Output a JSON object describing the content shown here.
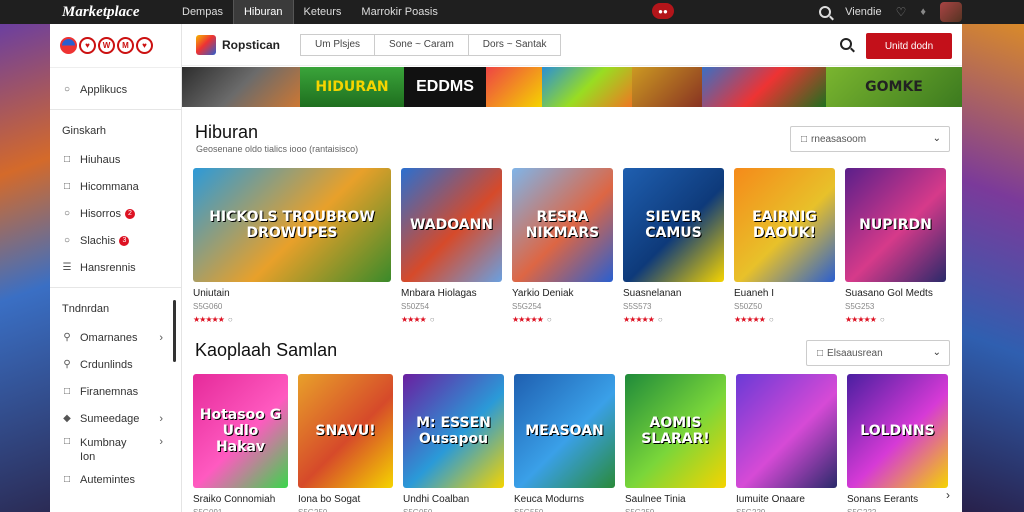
{
  "topbar": {
    "brand": "Marketplace",
    "tabs": [
      "Dempas",
      "Hiburan",
      "Keteurs",
      "Marrokir Poasis"
    ],
    "active_tab": 1,
    "notification": "",
    "user_label": "Viendie"
  },
  "sidebar": {
    "logo_chips": [
      "",
      "♥",
      "W",
      "M",
      "♥"
    ],
    "items_top": [
      {
        "label": "Applikucs",
        "icon": "circle-icon"
      }
    ],
    "section1_title": "Ginskarh",
    "items_mid": [
      {
        "label": "Hiuhaus",
        "icon": "book-icon",
        "badge": ""
      },
      {
        "label": "Hicommana",
        "icon": "card-icon",
        "badge": ""
      },
      {
        "label": "Hisorros",
        "icon": "circle-icon",
        "badge": "2"
      },
      {
        "label": "Slachis",
        "icon": "circle-icon",
        "badge": "3"
      },
      {
        "label": "Hansrennis",
        "icon": "list-icon",
        "badge": ""
      }
    ],
    "section2_title": "Tndnrdan",
    "items_bottom": [
      {
        "label": "Omarnanes",
        "icon": "search-icon",
        "chevron": "›"
      },
      {
        "label": "Crdunlinds",
        "icon": "search-icon",
        "chevron": ""
      },
      {
        "label": "Firanemnas",
        "icon": "book-icon",
        "chevron": ""
      },
      {
        "label": "Sumeedage",
        "icon": "tag-icon",
        "chevron": "›"
      },
      {
        "label": "Kumbnay",
        "sublabel": "Ion",
        "icon": "card-icon",
        "chevron": "›"
      },
      {
        "label": "Autemintes",
        "icon": "book-icon",
        "chevron": ""
      }
    ]
  },
  "header": {
    "store_name": "Ropstican",
    "chips": [
      "Um Plsjes",
      "Sone ~ Caram",
      "Dors ~ Santak"
    ],
    "cta_label": "Unitd dodn"
  },
  "banner": [
    "",
    "HIDURAN",
    "EDDMS",
    "",
    "",
    "",
    "",
    "GOMKE"
  ],
  "section1": {
    "title": "Hiburan",
    "subtitle": "Geosenane oldo tialics iooo (rantaisisco)",
    "dropdown": "rneasasoom",
    "cards": [
      {
        "thumb": "HICKOLS TROUBROW DROWUPES",
        "name": "Uniutain",
        "price": "S5G060",
        "stars": "★★★★★",
        "colors": [
          "#2d9ad8",
          "#e8a02a",
          "#3a8a2a"
        ]
      },
      {
        "thumb": "WADOANN",
        "name": "Mnbara Hiolagas",
        "price": "S50Z54",
        "stars": "★★★★",
        "colors": [
          "#2a6fd0",
          "#d64a2a",
          "#6aa0e0"
        ]
      },
      {
        "thumb": "RESRA NIKMARS",
        "name": "Yarkio Deniak",
        "price": "S5G254",
        "stars": "★★★★★",
        "colors": [
          "#7fb4e8",
          "#d64",
          "#2a5fd0"
        ]
      },
      {
        "thumb": "SIEVER CAMUS",
        "name": "Suasnelanan",
        "price": "S5S573",
        "stars": "★★★★★",
        "colors": [
          "#1f5fb0",
          "#0e3a7a",
          "#f5d400"
        ]
      },
      {
        "thumb": "EAIRNIG DAOUK!",
        "name": "Euaneh I",
        "price": "S50Z50",
        "stars": "★★★★★",
        "colors": [
          "#f58a1a",
          "#e8c12a",
          "#2a5fd0"
        ]
      },
      {
        "thumb": "NUPIRDN",
        "name": "Suasano Gol Medts",
        "price": "S5G253",
        "stars": "★★★★★",
        "colors": [
          "#5a1f8a",
          "#d63a8a",
          "#2a2a6a"
        ]
      }
    ]
  },
  "section2": {
    "title": "Kaoplaah Samlan",
    "dropdown": "Elsaausrean",
    "cards": [
      {
        "thumb": "Hotasoo G Udlo Hakav",
        "name": "Sraiko Connomiah",
        "price": "S5G091",
        "colors": [
          "#e52a9a",
          "#ff5ac0",
          "#3ad64a"
        ]
      },
      {
        "thumb": "SNAVU!",
        "name": "Iona bo Sogat",
        "price": "S5G250",
        "colors": [
          "#e8a02a",
          "#d64a2a",
          "#f5d400"
        ]
      },
      {
        "thumb": "M: ESSEN Ousapou",
        "name": "Undhi Coalban",
        "price": "S5G050",
        "colors": [
          "#6a1fa0",
          "#2a9ad8",
          "#f5d400"
        ]
      },
      {
        "thumb": "MEASOAN",
        "name": "Keuca Modurns",
        "price": "S5G550",
        "colors": [
          "#1f5fb0",
          "#3aa0e8",
          "#2a8a3a"
        ]
      },
      {
        "thumb": "AOMIS SLARAR!",
        "name": "Saulnee Tinia",
        "price": "S5G259",
        "colors": [
          "#1f8a3a",
          "#7ad63a",
          "#f5d400"
        ]
      },
      {
        "thumb": "",
        "name": "Iumuite Onaare",
        "price": "S5G229",
        "colors": [
          "#6a3ad6",
          "#d64ad6",
          "#2a2a6a"
        ]
      },
      {
        "thumb": "LOLDNNS",
        "name": "Sonans Eerants",
        "price": "S5G222",
        "colors": [
          "#4a1fa0",
          "#d63ad6",
          "#f5d400"
        ]
      }
    ],
    "next": "›"
  }
}
